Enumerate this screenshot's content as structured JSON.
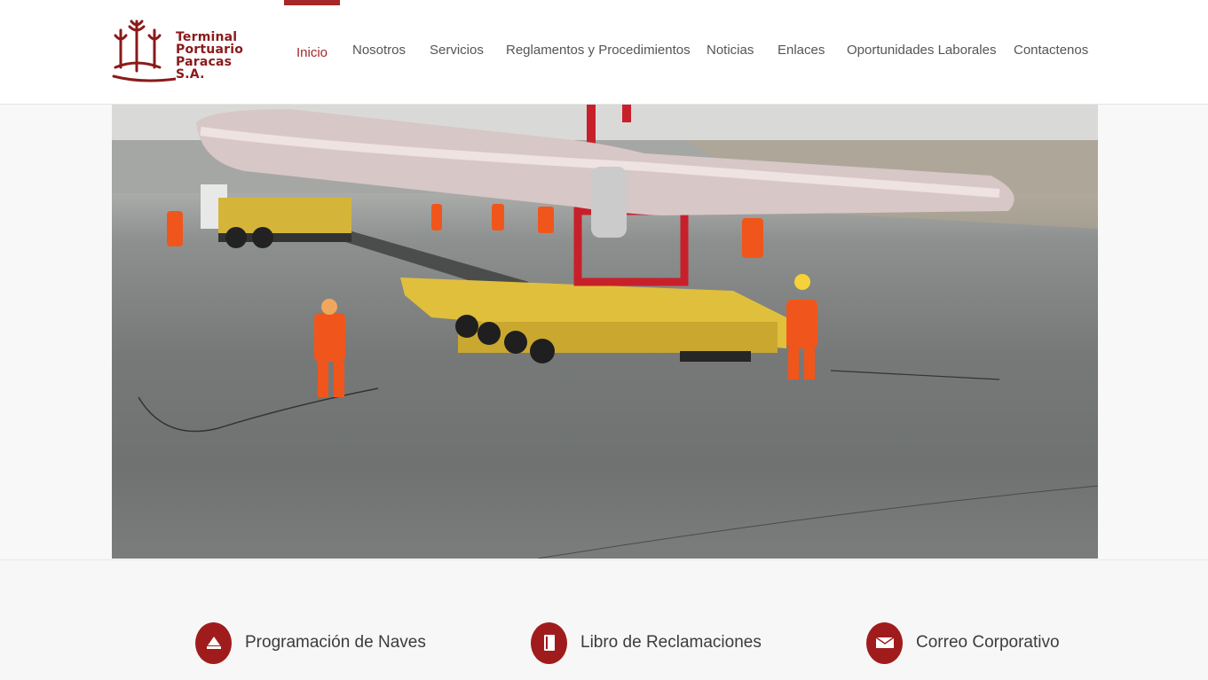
{
  "brand": {
    "name_lines": [
      "Terminal",
      "Portuario",
      "Paracas S.A."
    ],
    "color": "#a52727"
  },
  "nav": {
    "items": [
      {
        "label": "Inicio",
        "active": true
      },
      {
        "label": "Nosotros"
      },
      {
        "label": "Servicios"
      },
      {
        "label": "Reglamentos y Procedimientos"
      },
      {
        "label": "Noticias"
      },
      {
        "label": "Enlaces"
      },
      {
        "label": "Oportunidades Laborales"
      },
      {
        "label": "Contactenos"
      }
    ]
  },
  "hero": {
    "icon": "wind-turbine-blade-transport-photo"
  },
  "quick_links": [
    {
      "label": "Programación de Naves",
      "icon": "ship-icon"
    },
    {
      "label": "Libro de Reclamaciones",
      "icon": "book-icon"
    },
    {
      "label": "Correo Corporativo",
      "icon": "mail-icon"
    }
  ]
}
